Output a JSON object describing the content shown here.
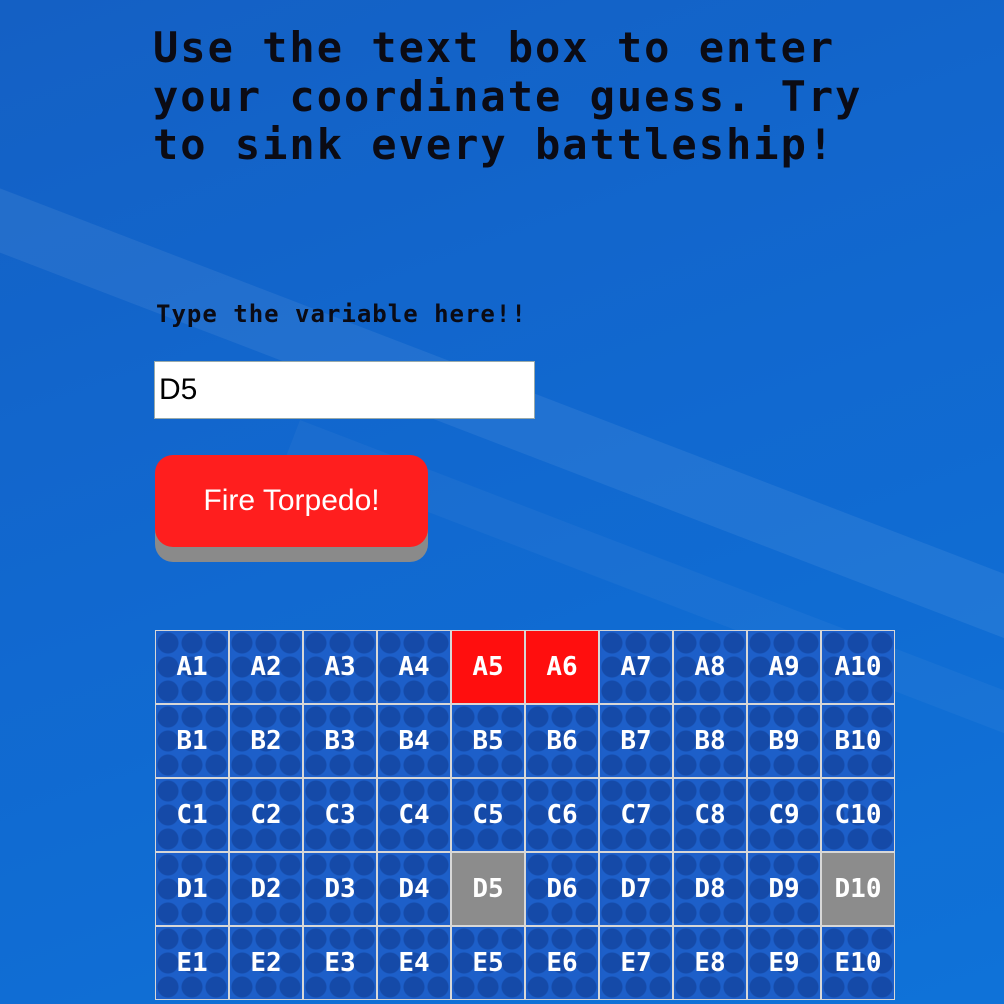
{
  "instructions": {
    "heading": "Use the text box to enter your coordinate guess. Try to sink every battleship!",
    "prompt": "Type the variable here!!"
  },
  "guess_input": {
    "value": "D5"
  },
  "fire_button": {
    "label": "Fire Torpedo!"
  },
  "colors": {
    "background": "#1168cf",
    "hit": "#ff0e0e",
    "miss": "#8c8c8c",
    "water": "#1d5fc9",
    "button": "#ff1e1e"
  },
  "board": {
    "rows": [
      {
        "cells": [
          {
            "label": "A1",
            "state": "water"
          },
          {
            "label": "A2",
            "state": "water"
          },
          {
            "label": "A3",
            "state": "water"
          },
          {
            "label": "A4",
            "state": "water"
          },
          {
            "label": "A5",
            "state": "hit"
          },
          {
            "label": "A6",
            "state": "hit"
          },
          {
            "label": "A7",
            "state": "water"
          },
          {
            "label": "A8",
            "state": "water"
          },
          {
            "label": "A9",
            "state": "water"
          },
          {
            "label": "A10",
            "state": "water"
          }
        ]
      },
      {
        "cells": [
          {
            "label": "B1",
            "state": "water"
          },
          {
            "label": "B2",
            "state": "water"
          },
          {
            "label": "B3",
            "state": "water"
          },
          {
            "label": "B4",
            "state": "water"
          },
          {
            "label": "B5",
            "state": "water"
          },
          {
            "label": "B6",
            "state": "water"
          },
          {
            "label": "B7",
            "state": "water"
          },
          {
            "label": "B8",
            "state": "water"
          },
          {
            "label": "B9",
            "state": "water"
          },
          {
            "label": "B10",
            "state": "water"
          }
        ]
      },
      {
        "cells": [
          {
            "label": "C1",
            "state": "water"
          },
          {
            "label": "C2",
            "state": "water"
          },
          {
            "label": "C3",
            "state": "water"
          },
          {
            "label": "C4",
            "state": "water"
          },
          {
            "label": "C5",
            "state": "water"
          },
          {
            "label": "C6",
            "state": "water"
          },
          {
            "label": "C7",
            "state": "water"
          },
          {
            "label": "C8",
            "state": "water"
          },
          {
            "label": "C9",
            "state": "water"
          },
          {
            "label": "C10",
            "state": "water"
          }
        ]
      },
      {
        "cells": [
          {
            "label": "D1",
            "state": "water"
          },
          {
            "label": "D2",
            "state": "water"
          },
          {
            "label": "D3",
            "state": "water"
          },
          {
            "label": "D4",
            "state": "water"
          },
          {
            "label": "D5",
            "state": "miss"
          },
          {
            "label": "D6",
            "state": "water"
          },
          {
            "label": "D7",
            "state": "water"
          },
          {
            "label": "D8",
            "state": "water"
          },
          {
            "label": "D9",
            "state": "water"
          },
          {
            "label": "D10",
            "state": "miss"
          }
        ]
      },
      {
        "cells": [
          {
            "label": "E1",
            "state": "water"
          },
          {
            "label": "E2",
            "state": "water"
          },
          {
            "label": "E3",
            "state": "water"
          },
          {
            "label": "E4",
            "state": "water"
          },
          {
            "label": "E5",
            "state": "water"
          },
          {
            "label": "E6",
            "state": "water"
          },
          {
            "label": "E7",
            "state": "water"
          },
          {
            "label": "E8",
            "state": "water"
          },
          {
            "label": "E9",
            "state": "water"
          },
          {
            "label": "E10",
            "state": "water"
          }
        ]
      }
    ]
  }
}
